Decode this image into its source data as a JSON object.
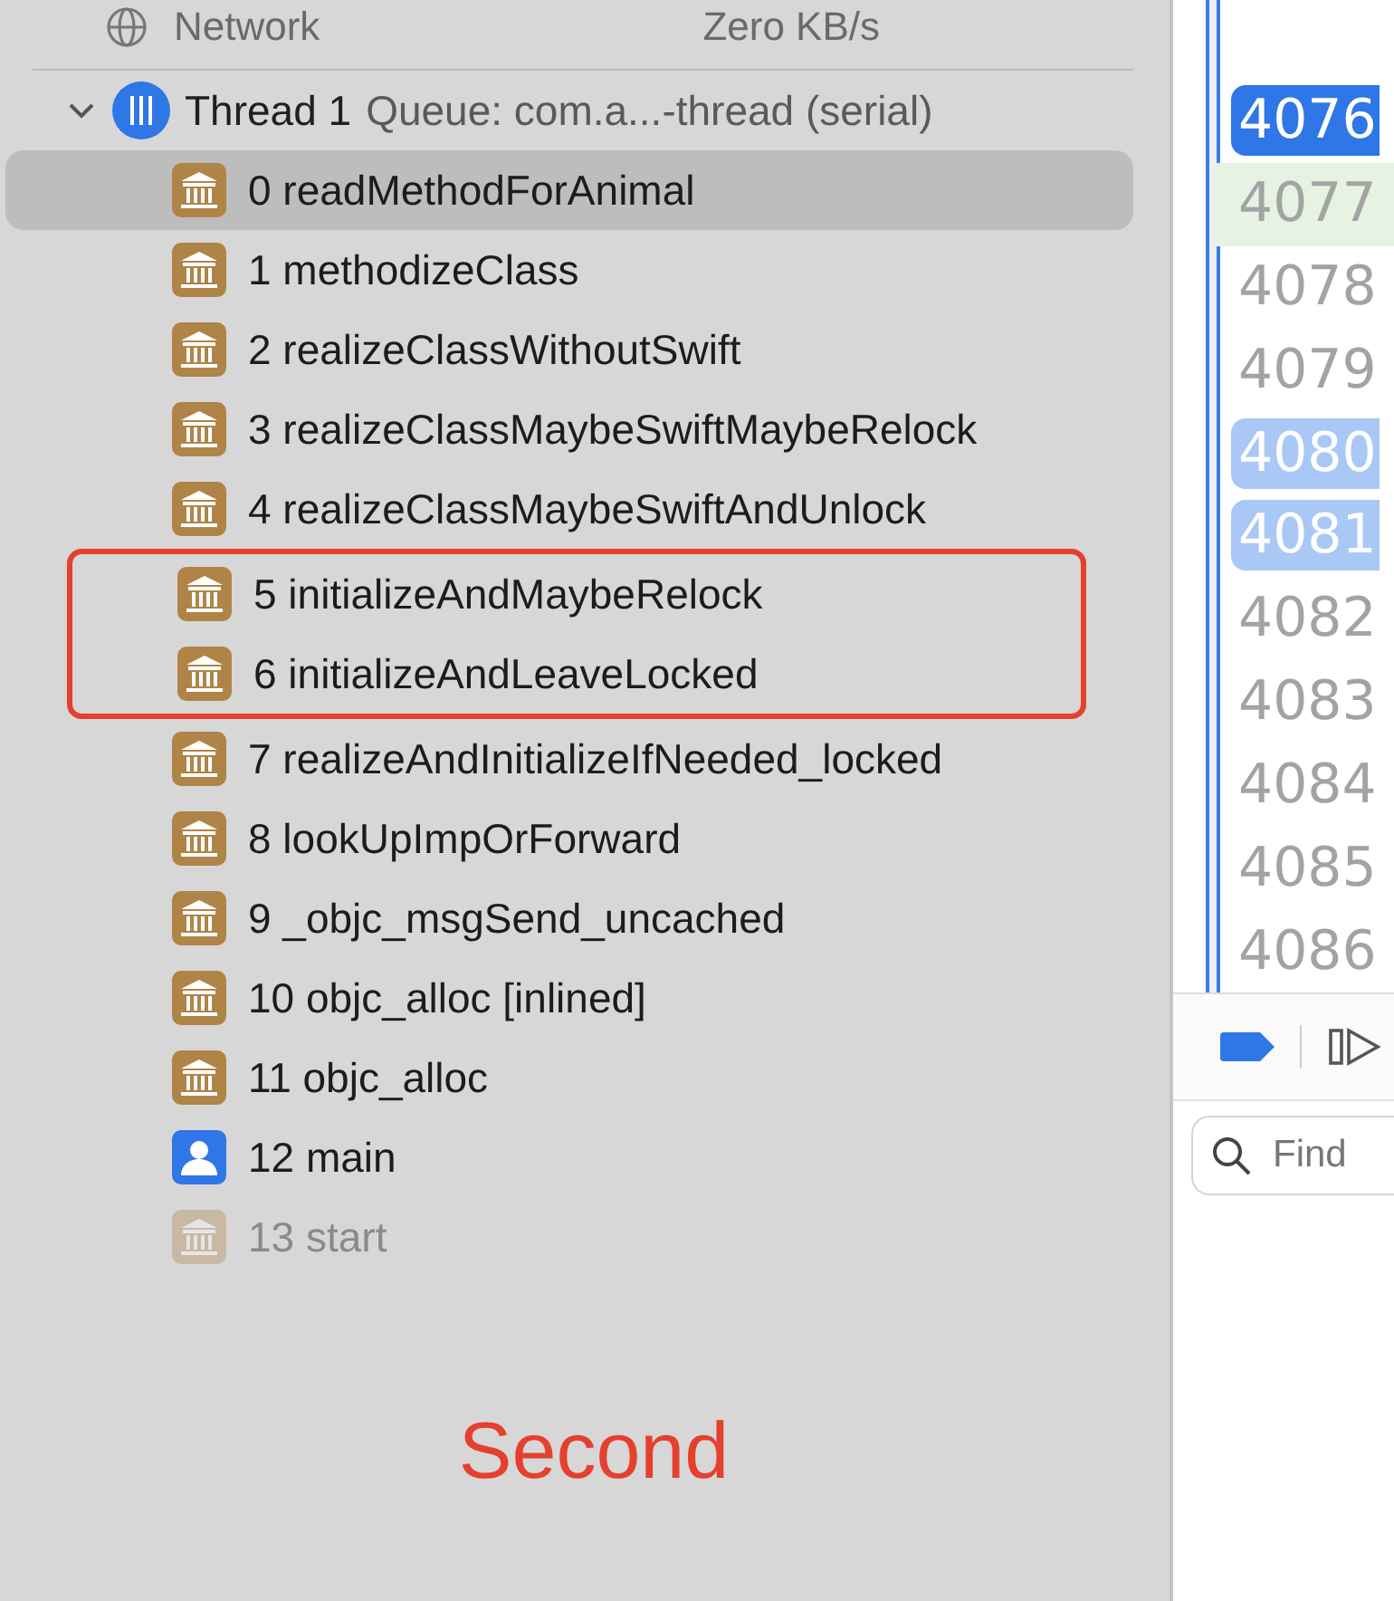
{
  "network": {
    "label": "Network",
    "rate": "Zero KB/s"
  },
  "thread": {
    "name": "Thread 1",
    "queue": "Queue: com.a...-thread (serial)",
    "expanded": true
  },
  "frames": [
    {
      "label": "0 readMethodForAnimal",
      "kind": "library",
      "selected": true,
      "dimmed": false,
      "boxed": false
    },
    {
      "label": "1 methodizeClass",
      "kind": "library",
      "selected": false,
      "dimmed": false,
      "boxed": false
    },
    {
      "label": "2 realizeClassWithoutSwift",
      "kind": "library",
      "selected": false,
      "dimmed": false,
      "boxed": false
    },
    {
      "label": "3 realizeClassMaybeSwiftMaybeRelock",
      "kind": "library",
      "selected": false,
      "dimmed": false,
      "boxed": false
    },
    {
      "label": "4 realizeClassMaybeSwiftAndUnlock",
      "kind": "library",
      "selected": false,
      "dimmed": false,
      "boxed": false
    },
    {
      "label": "5 initializeAndMaybeRelock",
      "kind": "library",
      "selected": false,
      "dimmed": false,
      "boxed": true
    },
    {
      "label": "6 initializeAndLeaveLocked",
      "kind": "library",
      "selected": false,
      "dimmed": false,
      "boxed": true
    },
    {
      "label": "7 realizeAndInitializeIfNeeded_locked",
      "kind": "library",
      "selected": false,
      "dimmed": false,
      "boxed": false
    },
    {
      "label": "8 lookUpImpOrForward",
      "kind": "library",
      "selected": false,
      "dimmed": false,
      "boxed": false
    },
    {
      "label": "9 _objc_msgSend_uncached",
      "kind": "library",
      "selected": false,
      "dimmed": false,
      "boxed": false
    },
    {
      "label": "10 objc_alloc [inlined]",
      "kind": "library",
      "selected": false,
      "dimmed": false,
      "boxed": false
    },
    {
      "label": "11 objc_alloc",
      "kind": "library",
      "selected": false,
      "dimmed": false,
      "boxed": false
    },
    {
      "label": "12 main",
      "kind": "user",
      "selected": false,
      "dimmed": false,
      "boxed": false
    },
    {
      "label": "13 start",
      "kind": "library",
      "selected": false,
      "dimmed": true,
      "boxed": false
    }
  ],
  "annotation": "Second",
  "line_numbers": [
    {
      "number": "4076",
      "kind": "current"
    },
    {
      "number": "4077",
      "kind": "executing"
    },
    {
      "number": "4078",
      "kind": "plain"
    },
    {
      "number": "4079",
      "kind": "plain"
    },
    {
      "number": "4080",
      "kind": "breakpoint"
    },
    {
      "number": "4081",
      "kind": "breakpoint"
    },
    {
      "number": "4082",
      "kind": "plain"
    },
    {
      "number": "4083",
      "kind": "plain"
    },
    {
      "number": "4084",
      "kind": "plain"
    },
    {
      "number": "4085",
      "kind": "plain"
    },
    {
      "number": "4086",
      "kind": "plain"
    }
  ],
  "find": {
    "placeholder": "Find"
  }
}
